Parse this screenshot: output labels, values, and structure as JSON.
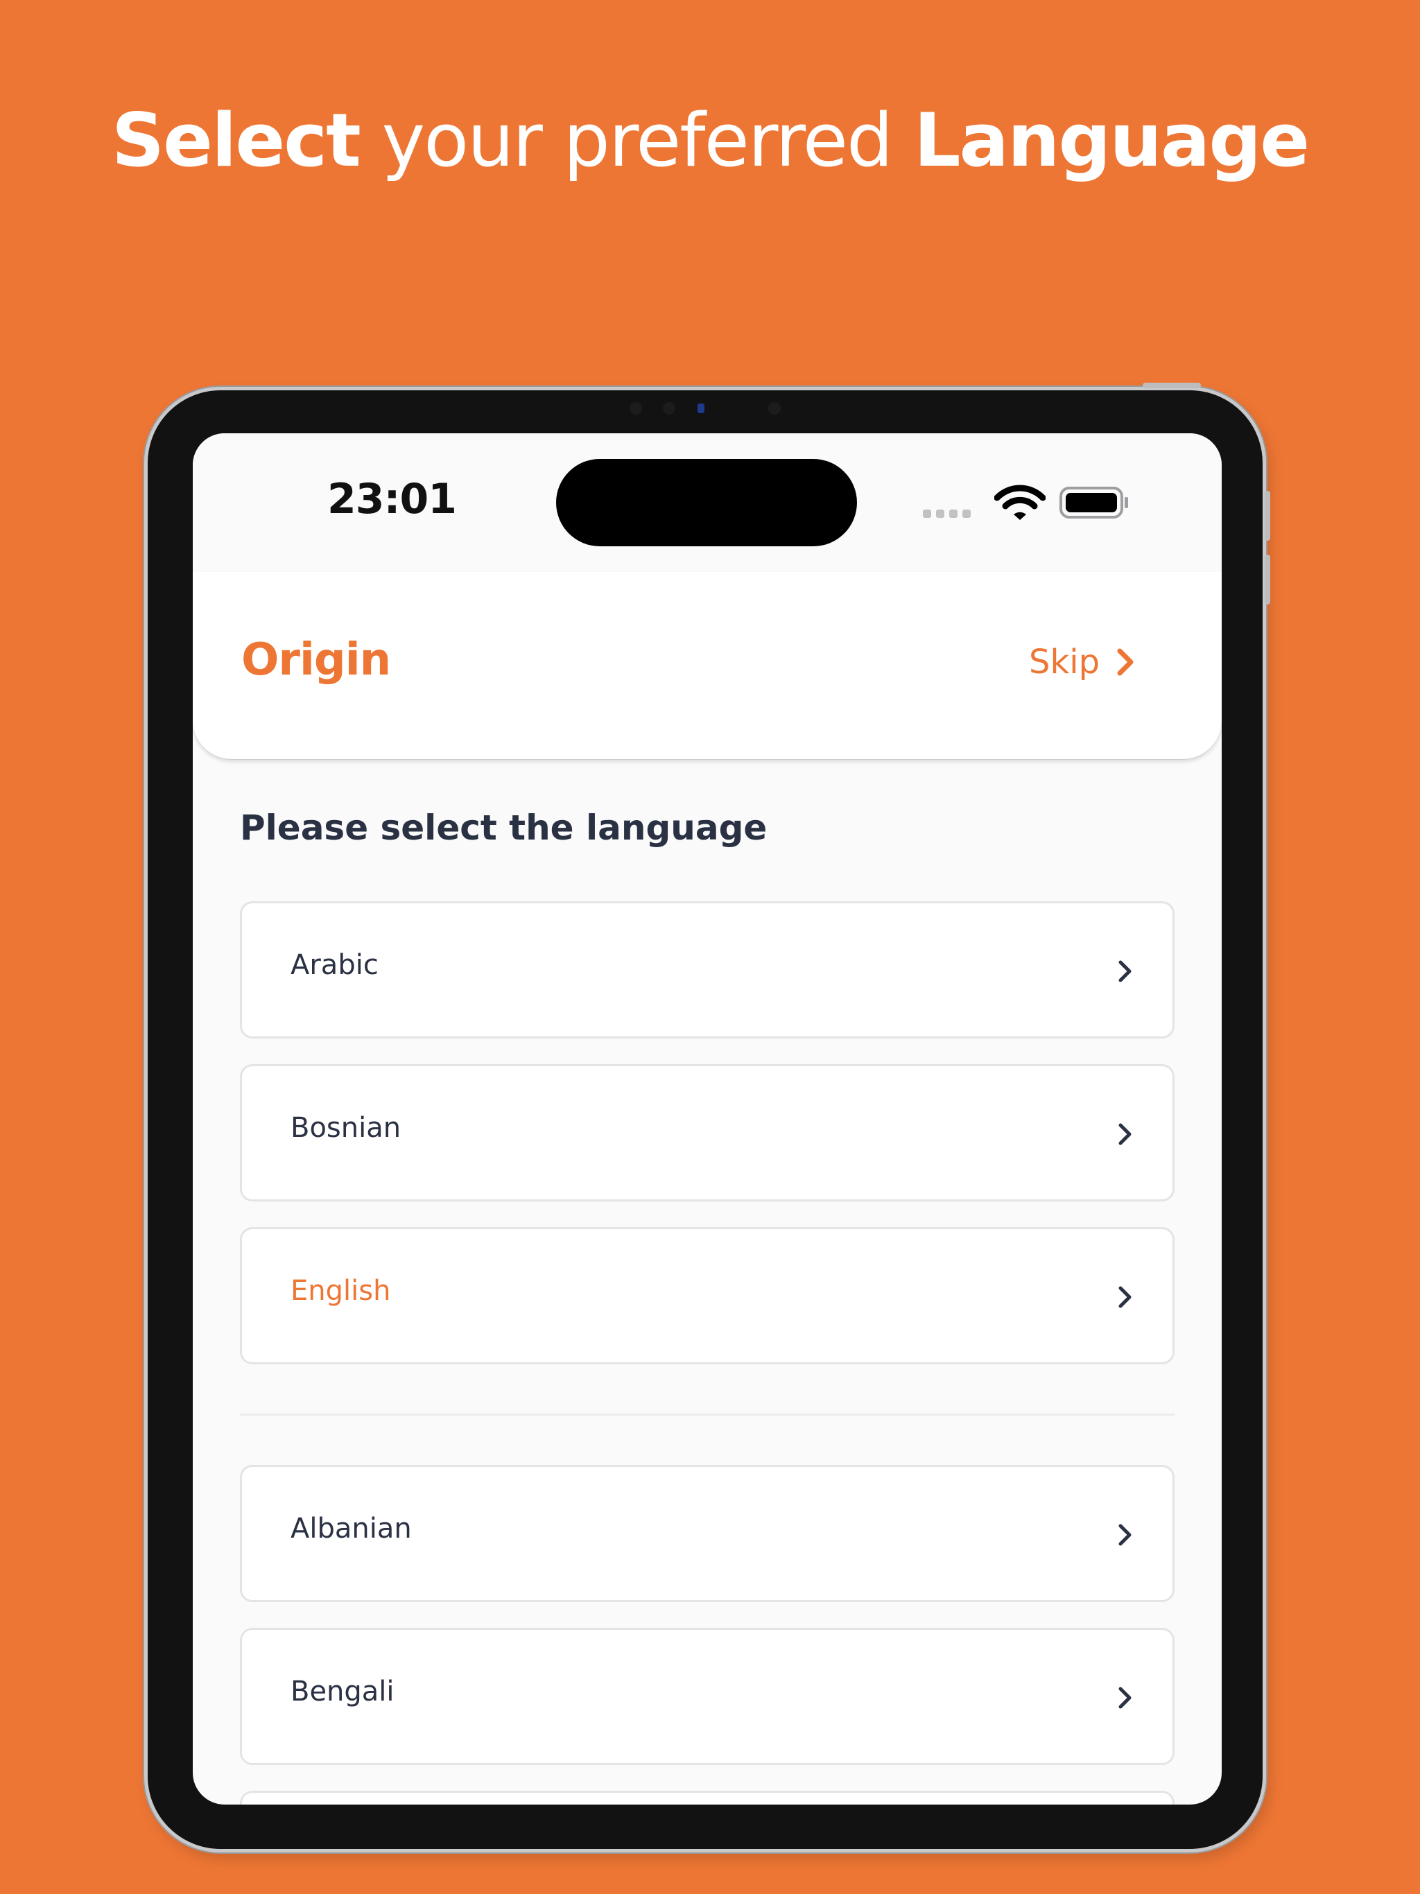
{
  "headline": {
    "part1": "Select",
    "part2": " your preferred ",
    "part3": "Language"
  },
  "statusbar": {
    "time": "23:01"
  },
  "header": {
    "title": "Origin",
    "skip_label": "Skip"
  },
  "section_title": "Please select the language",
  "languages": [
    {
      "label": "Arabic",
      "selected": false
    },
    {
      "label": "Bosnian",
      "selected": false
    },
    {
      "label": "English",
      "selected": true
    },
    {
      "label": "Albanian",
      "selected": false
    },
    {
      "label": "Bengali",
      "selected": false
    }
  ],
  "colors": {
    "accent": "#EE7634",
    "text": "#2A3143",
    "background": "#EE7634"
  },
  "icons": {
    "skip": "chevron-right-icon",
    "item": "chevron-right-icon",
    "wifi": "wifi-icon",
    "battery": "battery-icon"
  }
}
